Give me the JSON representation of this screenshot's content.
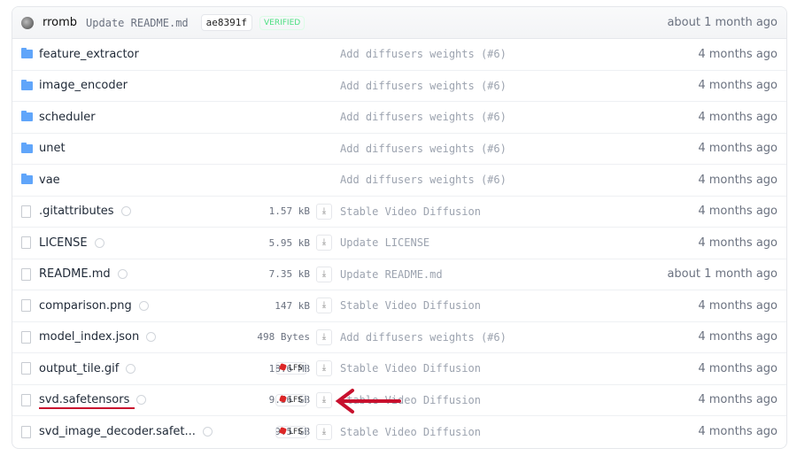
{
  "commit": {
    "user": "rromb",
    "message": "Update README.md",
    "hash": "ae8391f",
    "badge": "VERIFIED",
    "date": "about 1 month ago"
  },
  "rows": [
    {
      "type": "folder",
      "name": "feature_extractor",
      "commit": "Add diffusers weights (#6)",
      "date": "4 months ago"
    },
    {
      "type": "folder",
      "name": "image_encoder",
      "commit": "Add diffusers weights (#6)",
      "date": "4 months ago"
    },
    {
      "type": "folder",
      "name": "scheduler",
      "commit": "Add diffusers weights (#6)",
      "date": "4 months ago"
    },
    {
      "type": "folder",
      "name": "unet",
      "commit": "Add diffusers weights (#6)",
      "date": "4 months ago"
    },
    {
      "type": "folder",
      "name": "vae",
      "commit": "Add diffusers weights (#6)",
      "date": "4 months ago"
    },
    {
      "type": "file",
      "name": ".gitattributes",
      "size": "1.57 kB",
      "commit": "Stable Video Diffusion",
      "date": "4 months ago"
    },
    {
      "type": "file",
      "name": "LICENSE",
      "size": "5.95 kB",
      "commit": "Update LICENSE",
      "date": "4 months ago"
    },
    {
      "type": "file",
      "name": "README.md",
      "size": "7.35 kB",
      "commit": "Update README.md",
      "date": "about 1 month ago"
    },
    {
      "type": "file",
      "name": "comparison.png",
      "size": "147 kB",
      "commit": "Stable Video Diffusion",
      "date": "4 months ago"
    },
    {
      "type": "file",
      "name": "model_index.json",
      "size": "498 Bytes",
      "commit": "Add diffusers weights (#6)",
      "date": "4 months ago"
    },
    {
      "type": "file",
      "name": "output_tile.gif",
      "size": "18.6 MB",
      "lfs": "LFS",
      "commit": "Stable Video Diffusion",
      "date": "4 months ago"
    },
    {
      "type": "file",
      "name": "svd.safetensors",
      "size": "9.56 GB",
      "lfs": "LFS",
      "commit": "Stable Video Diffusion",
      "date": "4 months ago"
    },
    {
      "type": "file",
      "name": "svd_image_decoder.safet...",
      "size": "9.5 GB",
      "lfs": "LFS",
      "commit": "Stable Video Diffusion",
      "date": "4 months ago"
    }
  ],
  "annotation_color": "#c8102e"
}
